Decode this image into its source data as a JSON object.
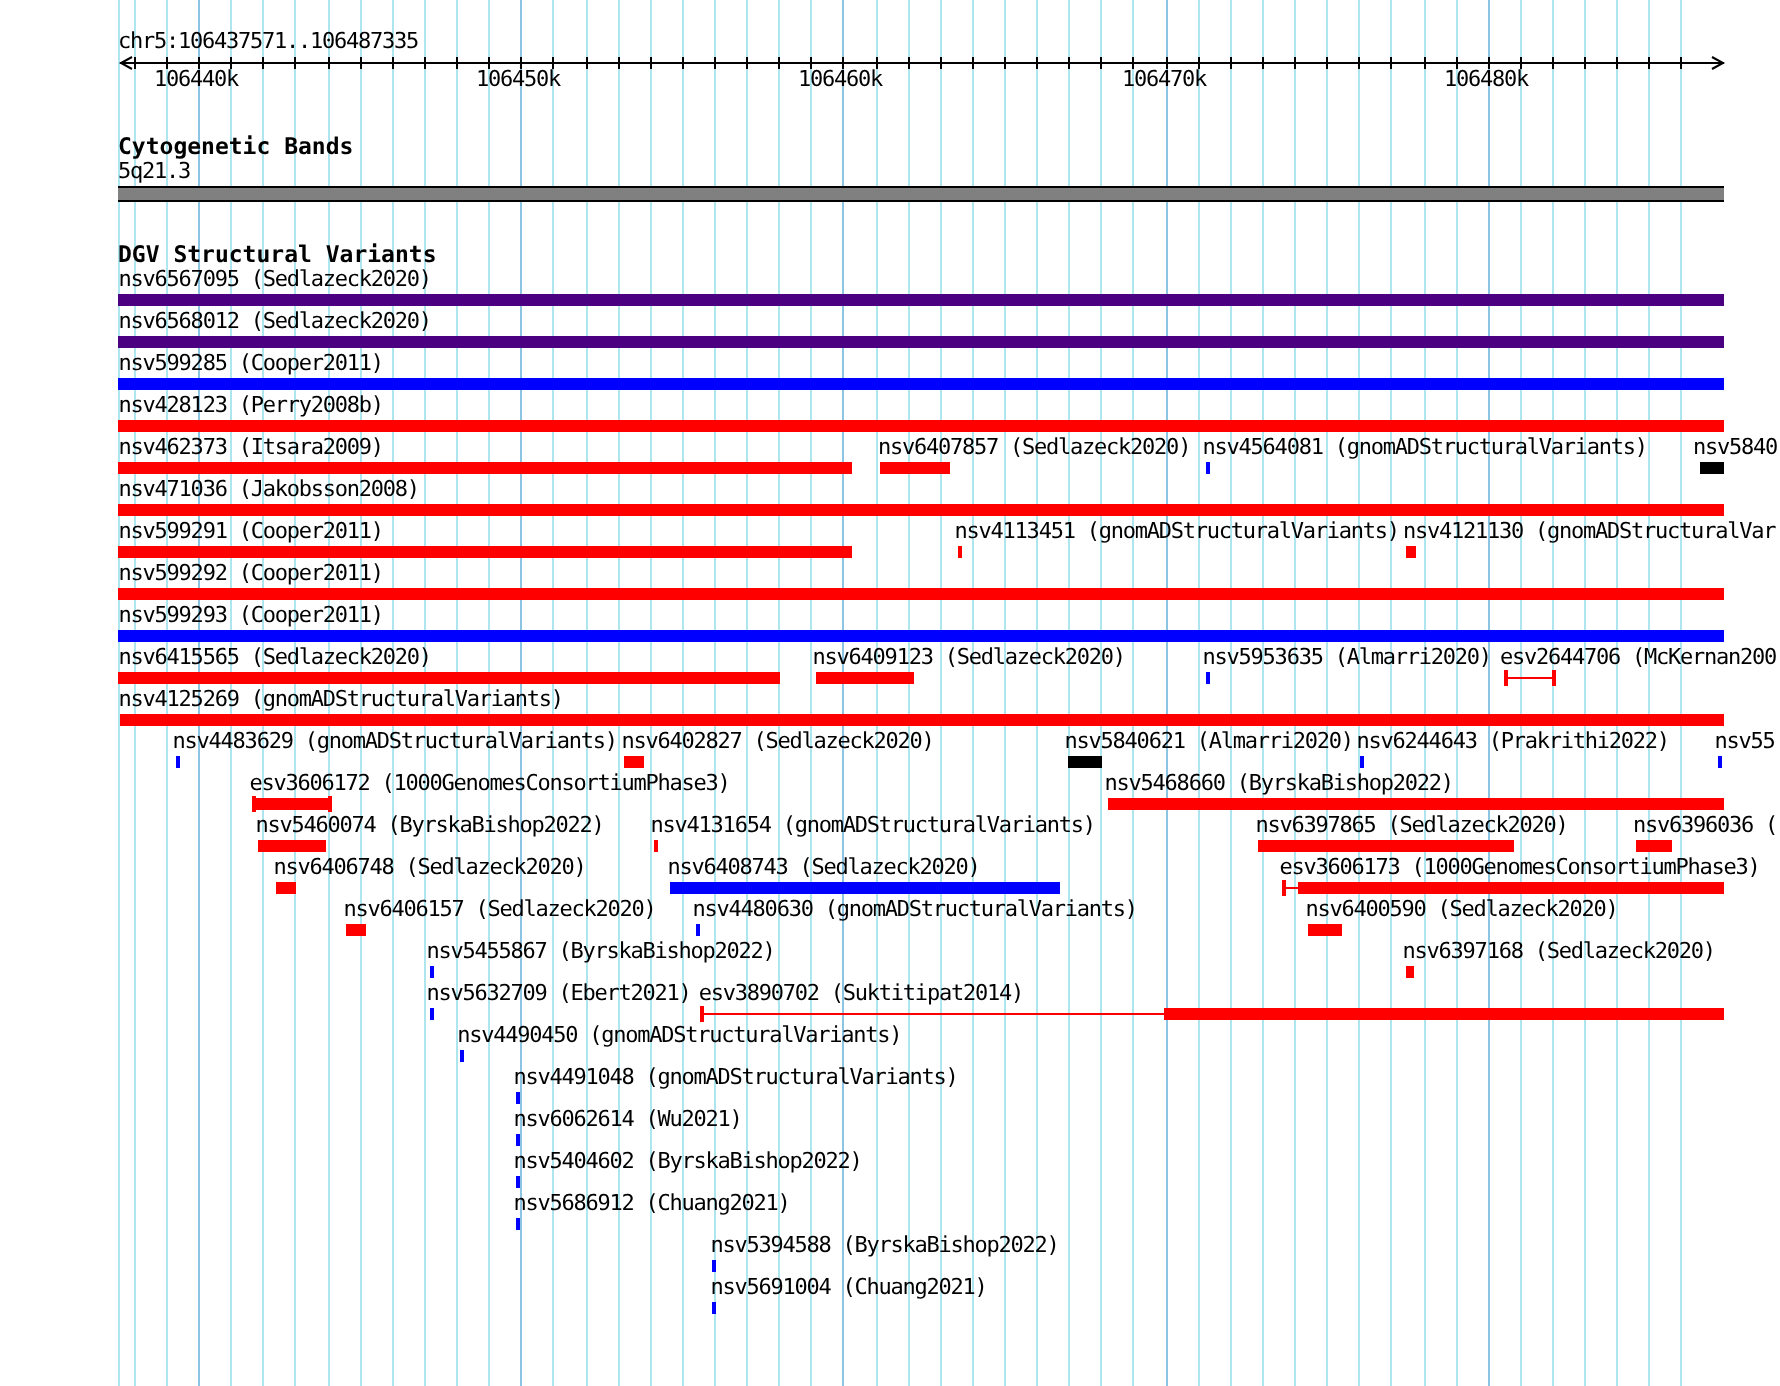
{
  "ruler": {
    "location": "chr5:106437571..106487335",
    "ticks": [
      "106440k",
      "106450k",
      "106460k",
      "106470k",
      "106480k"
    ]
  },
  "tracks": [
    {
      "title": "Cytogenetic Bands",
      "features": [
        {
          "label": "5q21.3",
          "kind": "band",
          "color": "#808080"
        }
      ]
    },
    {
      "title": "DGV Structural Variants",
      "features": [
        {
          "label": "nsv6567095 (Sedlazeck2020)",
          "kind": "bar",
          "color": "#4b0082"
        },
        {
          "label": "nsv6568012 (Sedlazeck2020)",
          "kind": "bar",
          "color": "#4b0082"
        },
        {
          "label": "nsv599285 (Cooper2011)",
          "kind": "bar",
          "color": "#0000ff"
        },
        {
          "label": "nsv428123 (Perry2008b)",
          "kind": "bar",
          "color": "#ff0000"
        },
        {
          "label": "nsv462373 (Itsara2009)",
          "kind": "bar",
          "color": "#ff0000"
        },
        {
          "label": "nsv6407857 (Sedlazeck2020)",
          "kind": "bar",
          "color": "#ff0000"
        },
        {
          "label": "nsv4564081 (gnomADStructuralVariants)",
          "kind": "bar",
          "color": "#0000ff"
        },
        {
          "label": "nsv5840",
          "kind": "bar",
          "color": "#000000"
        },
        {
          "label": "nsv471036 (Jakobsson2008)",
          "kind": "bar",
          "color": "#ff0000"
        },
        {
          "label": "nsv599291 (Cooper2011)",
          "kind": "bar",
          "color": "#ff0000"
        },
        {
          "label": "nsv4113451 (gnomADStructuralVariants)",
          "kind": "bar",
          "color": "#ff0000"
        },
        {
          "label": "nsv4121130 (gnomADStructuralVar",
          "kind": "bar",
          "color": "#ff0000"
        },
        {
          "label": "nsv599292 (Cooper2011)",
          "kind": "bar",
          "color": "#ff0000"
        },
        {
          "label": "nsv599293 (Cooper2011)",
          "kind": "bar",
          "color": "#0000ff"
        },
        {
          "label": "nsv6415565 (Sedlazeck2020)",
          "kind": "bar",
          "color": "#ff0000"
        },
        {
          "label": "nsv6409123 (Sedlazeck2020)",
          "kind": "bar",
          "color": "#ff0000"
        },
        {
          "label": "nsv5953635 (Almarri2020)",
          "kind": "bar",
          "color": "#0000ff"
        },
        {
          "label": "esv2644706 (McKernan200",
          "kind": "span",
          "color": "#ff0000"
        },
        {
          "label": "nsv4125269 (gnomADStructuralVariants)",
          "kind": "bar",
          "color": "#ff0000"
        },
        {
          "label": "nsv4483629 (gnomADStructuralVariants)",
          "kind": "bar",
          "color": "#0000ff"
        },
        {
          "label": "nsv6402827 (Sedlazeck2020)",
          "kind": "bar",
          "color": "#ff0000"
        },
        {
          "label": "nsv5840621 (Almarri2020)",
          "kind": "bar",
          "color": "#000000"
        },
        {
          "label": "nsv6244643 (Prakrithi2022)",
          "kind": "bar",
          "color": "#0000ff"
        },
        {
          "label": "nsv55",
          "kind": "bar",
          "color": "#0000ff"
        },
        {
          "label": "esv3606172 (1000GenomesConsortiumPhase3)",
          "kind": "span",
          "color": "#ff0000"
        },
        {
          "label": "nsv5468660 (ByrskaBishop2022)",
          "kind": "bar",
          "color": "#ff0000"
        },
        {
          "label": "nsv5460074 (ByrskaBishop2022)",
          "kind": "bar",
          "color": "#ff0000"
        },
        {
          "label": "nsv4131654 (gnomADStructuralVariants)",
          "kind": "bar",
          "color": "#ff0000"
        },
        {
          "label": "nsv6397865 (Sedlazeck2020)",
          "kind": "bar",
          "color": "#ff0000"
        },
        {
          "label": "nsv6396036 (",
          "kind": "bar",
          "color": "#ff0000"
        },
        {
          "label": "nsv6406748 (Sedlazeck2020)",
          "kind": "bar",
          "color": "#ff0000"
        },
        {
          "label": "nsv6408743 (Sedlazeck2020)",
          "kind": "bar",
          "color": "#0000ff"
        },
        {
          "label": "esv3606173 (1000GenomesConsortiumPhase3)",
          "kind": "span",
          "color": "#ff0000"
        },
        {
          "label": "nsv6406157 (Sedlazeck2020)",
          "kind": "bar",
          "color": "#ff0000"
        },
        {
          "label": "nsv4480630 (gnomADStructuralVariants)",
          "kind": "bar",
          "color": "#0000ff"
        },
        {
          "label": "nsv6400590 (Sedlazeck2020)",
          "kind": "bar",
          "color": "#ff0000"
        },
        {
          "label": "nsv5455867 (ByrskaBishop2022)",
          "kind": "bar",
          "color": "#0000ff"
        },
        {
          "label": "nsv6397168 (Sedlazeck2020)",
          "kind": "bar",
          "color": "#ff0000"
        },
        {
          "label": "nsv5632709 (Ebert2021)",
          "kind": "bar",
          "color": "#0000ff"
        },
        {
          "label": "esv3890702 (Suktitipat2014)",
          "kind": "span",
          "color": "#ff0000"
        },
        {
          "label": "nsv4490450 (gnomADStructuralVariants)",
          "kind": "bar",
          "color": "#0000ff"
        },
        {
          "label": "nsv4491048 (gnomADStructuralVariants)",
          "kind": "bar",
          "color": "#0000ff"
        },
        {
          "label": "nsv6062614 (Wu2021)",
          "kind": "bar",
          "color": "#0000ff"
        },
        {
          "label": "nsv5404602 (ByrskaBishop2022)",
          "kind": "bar",
          "color": "#0000ff"
        },
        {
          "label": "nsv5686912 (Chuang2021)",
          "kind": "bar",
          "color": "#0000ff"
        },
        {
          "label": "nsv5394588 (ByrskaBishop2022)",
          "kind": "bar",
          "color": "#0000ff"
        },
        {
          "label": "nsv5691004 (Chuang2021)",
          "kind": "bar",
          "color": "#0000ff"
        }
      ]
    }
  ]
}
